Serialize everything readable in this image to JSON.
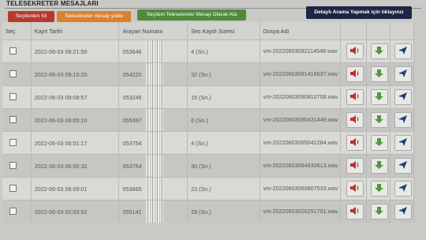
{
  "header": {
    "title": "TELESEKRETER MESAJLARI",
    "buttons": {
      "delete_selected": "Seçilenleri Sil",
      "upload_message": "Telesekreter mesajı yükle",
      "set_selected": "Seçileni Telesekreter Mesajı Olarak Ata",
      "detailed_search": "Detaylı Arama Yapmak için tıklayınız"
    }
  },
  "table": {
    "columns": {
      "select": "Seç",
      "date": "Kayıt Tarihi",
      "caller": "Arayan Numara",
      "duration": "Ses Kaydı Süresi",
      "file": "Dosya Adı"
    },
    "rows": [
      {
        "date": "2022-06-03 09:21:50",
        "caller": "053646",
        "duration": "4 (Sn.)",
        "file": "vm-20220603092114548.wav"
      },
      {
        "date": "2022-06-03 09:15:20",
        "caller": "054220",
        "duration": "32 (Sn.)",
        "file": "vm-20220603091416637.wav"
      },
      {
        "date": "2022-06-03 09:08:57",
        "caller": "053245",
        "duration": "15 (Sn.)",
        "file": "vm-20220603090810708.wav"
      },
      {
        "date": "2022-06-03 09:05:10",
        "caller": "055397",
        "duration": "6 (Sn.)",
        "file": "vm-20220603090431449.wav"
      },
      {
        "date": "2022-06-03 06:51:17",
        "caller": "053754",
        "duration": "4 (Sn.)",
        "file": "vm-20220603065041284.wav"
      },
      {
        "date": "2022-06-03 06:50:32",
        "caller": "053754",
        "duration": "30 (Sn.)",
        "file": "vm-20220603064930613.wav"
      },
      {
        "date": "2022-06-03 06:09:01",
        "caller": "053865",
        "duration": "23 (Sn.)",
        "file": "vm-20220603060807533.wav"
      },
      {
        "date": "2022-06-03 02:03:52",
        "caller": "055141",
        "duration": "29 (Sn.)",
        "file": "vm-20220603020251701.wav"
      }
    ]
  },
  "icons": {
    "play": "speaker-icon",
    "download": "download-arrow-icon",
    "send": "send-icon"
  },
  "colors": {
    "delete": "#b63a2f",
    "upload": "#d8822f",
    "assign": "#4e8c3c",
    "search": "#1d2644",
    "speaker": "#c0302a",
    "download": "#4f9a3a",
    "send": "#1f3d73"
  }
}
